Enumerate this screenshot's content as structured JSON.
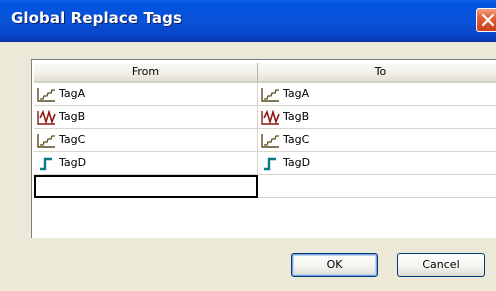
{
  "window": {
    "title": "Global Replace Tags"
  },
  "grid": {
    "columns": [
      "From",
      "To"
    ],
    "rows": [
      {
        "from": {
          "icon": "analog-trend-icon",
          "label": "TagA"
        },
        "to": {
          "icon": "analog-trend-icon",
          "label": "TagA"
        }
      },
      {
        "from": {
          "icon": "sine-wave-icon",
          "label": "TagB"
        },
        "to": {
          "icon": "sine-wave-icon",
          "label": "TagB"
        }
      },
      {
        "from": {
          "icon": "analog-trend-icon",
          "label": "TagC"
        },
        "to": {
          "icon": "analog-trend-icon",
          "label": "TagC"
        }
      },
      {
        "from": {
          "icon": "discrete-step-icon",
          "label": "TagD"
        },
        "to": {
          "icon": "discrete-step-icon",
          "label": "TagD"
        }
      },
      {
        "from": {
          "icon": "",
          "label": ""
        },
        "to": {
          "icon": "",
          "label": ""
        }
      }
    ]
  },
  "buttons": {
    "ok": "OK",
    "cancel": "Cancel"
  },
  "colors": {
    "titlebar": "#0053df",
    "close": "#e2603a",
    "dialog_bg": "#ece9d8",
    "analog": "#5a4a20",
    "sine": "#8b1a10",
    "discrete": "#0b7a86"
  }
}
